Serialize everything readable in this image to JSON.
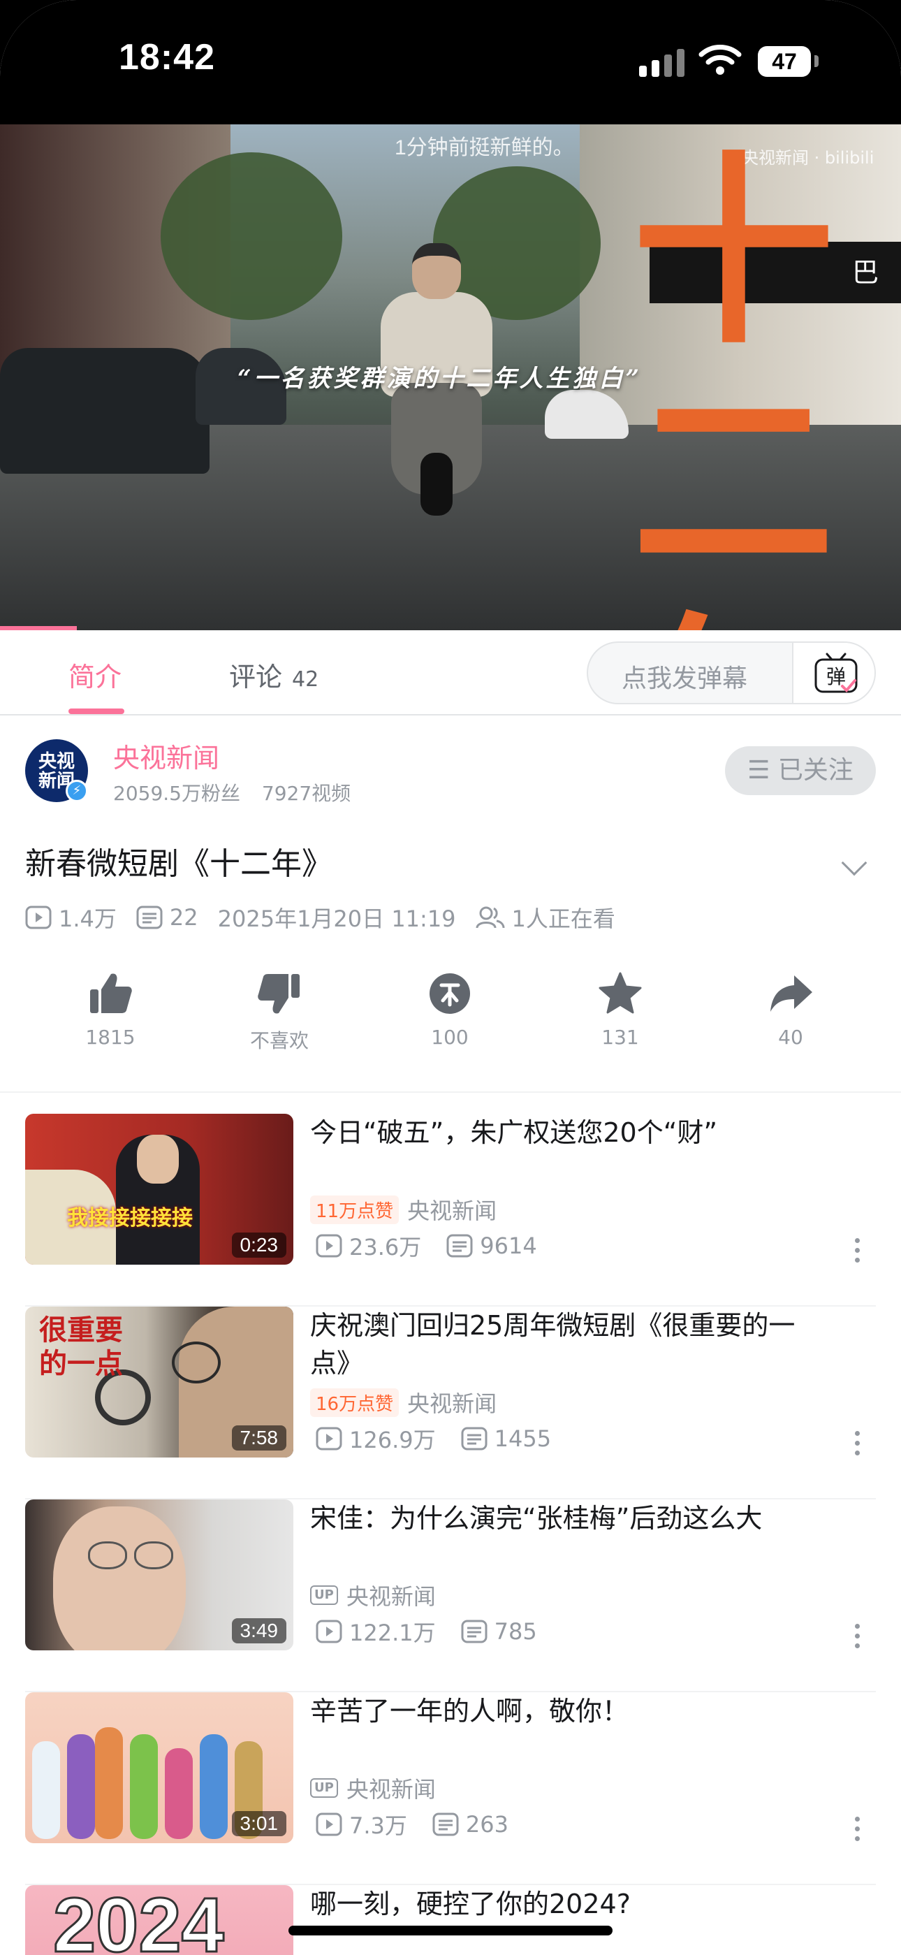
{
  "status_bar": {
    "time": "18:42",
    "battery": "47"
  },
  "player": {
    "top_caption": "1分钟前挺新鲜的。",
    "watermark": "央视新闻 · bilibili",
    "quote": "“一名获奖群演的十二年人生独白”",
    "title_art": "十二年",
    "shop_sign": "巴"
  },
  "tabs": {
    "intro_label": "简介",
    "comments_label": "评论",
    "comments_count": "42",
    "danmaku_placeholder": "点我发弹幕",
    "danmaku_button_glyph": "弹"
  },
  "owner": {
    "avatar_text_1": "央视",
    "avatar_text_2": "新闻",
    "name": "央视新闻",
    "fans": "2059.5万粉丝",
    "videos": "7927视频",
    "follow_label": "☰ 已关注"
  },
  "video": {
    "title": "新春微短剧《十二年》",
    "views": "1.4万",
    "danmaku": "22",
    "date": "2025年1月20日 11:19",
    "watching": "1人正在看"
  },
  "actions": {
    "like": "1815",
    "dislike": "不喜欢",
    "coin": "100",
    "favorite": "131",
    "share": "40"
  },
  "related": [
    {
      "title": "今日“破五”，朱广权送您20个“财”",
      "duration": "0:23",
      "badge": "11万点赞",
      "up": "央视新闻",
      "views": "23.6万",
      "danmaku": "9614",
      "thumb_text": "我接接接接接"
    },
    {
      "title": "庆祝澳门回归25周年微短剧《很重要的一点》",
      "duration": "7:58",
      "badge": "16万点赞",
      "up": "央视新闻",
      "views": "126.9万",
      "danmaku": "1455",
      "thumb_text": "很重要的一点"
    },
    {
      "title": "宋佳：为什么演完“张桂梅”后劲这么大",
      "duration": "3:49",
      "badge": "",
      "up": "央视新闻",
      "views": "122.1万",
      "danmaku": "785",
      "thumb_text": ""
    },
    {
      "title": "辛苦了一年的人啊，敬你！",
      "duration": "3:01",
      "badge": "",
      "up": "央视新闻",
      "views": "7.3万",
      "danmaku": "263",
      "thumb_text": ""
    },
    {
      "title": "哪一刻，硬控了你的2024?",
      "duration": "",
      "badge": "",
      "up": "",
      "views": "",
      "danmaku": "",
      "thumb_text": "2024"
    }
  ],
  "up_tag": "UP",
  "colors": {
    "accent": "#fb7299",
    "muted": "#9499a0",
    "text": "#18191c",
    "badge": "#ff6633"
  }
}
